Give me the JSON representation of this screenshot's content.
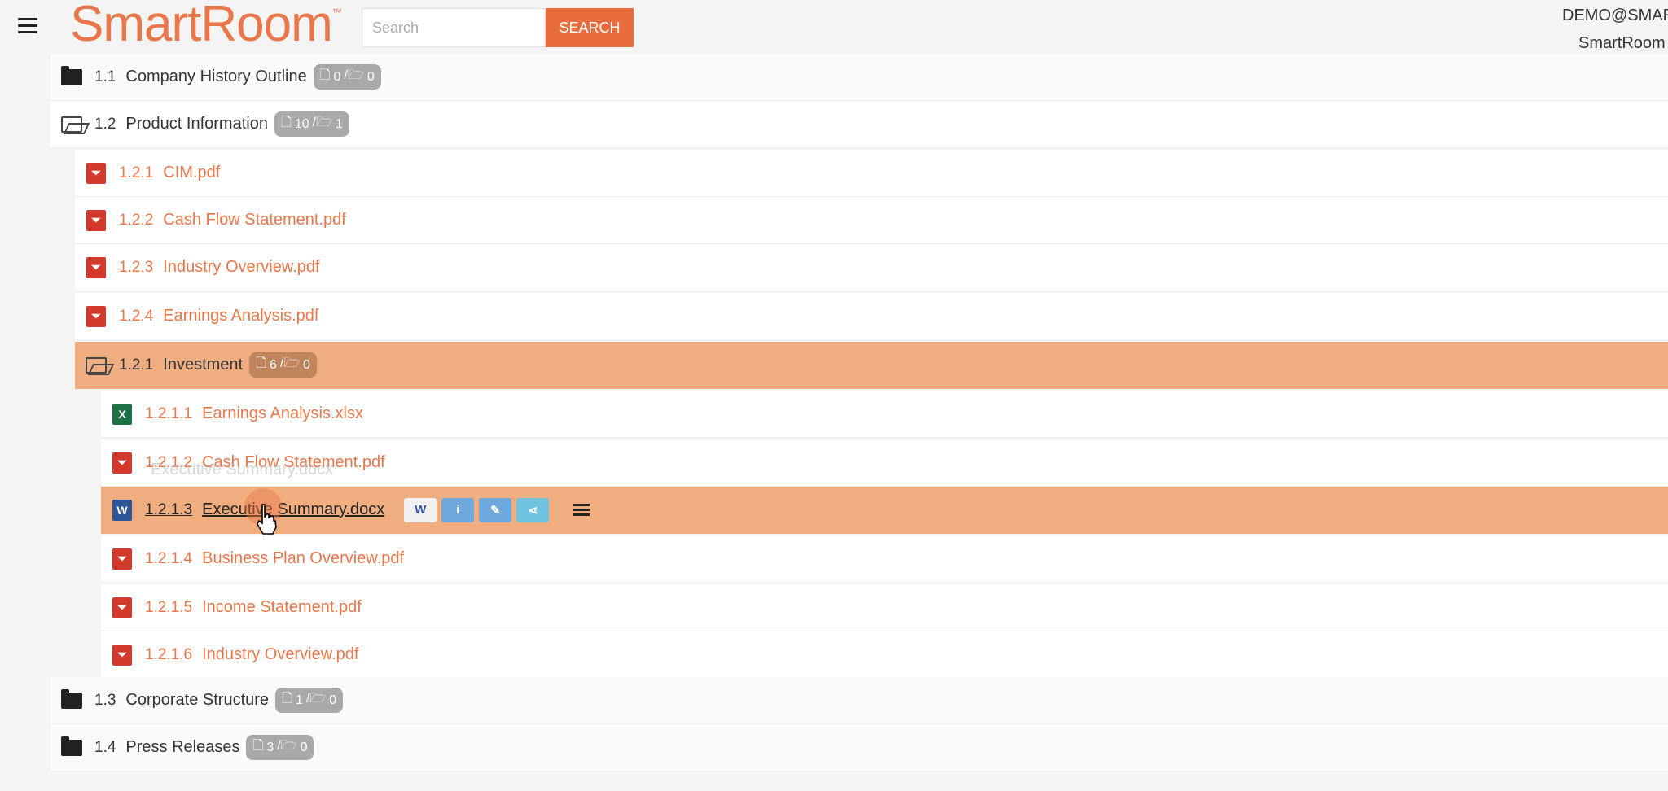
{
  "header": {
    "logo": "SmartRoom",
    "logo_tm": "™",
    "search_placeholder": "Search",
    "search_button": "SEARCH",
    "user": "DEMO@SMAR",
    "room": "SmartRoom"
  },
  "tree": [
    {
      "num": "1.1",
      "name": "Company History Outline",
      "type": "folder-closed",
      "files": "0",
      "folders": "0"
    },
    {
      "num": "1.2",
      "name": "Product Information",
      "type": "folder-open",
      "files": "10",
      "folders": "1"
    },
    {
      "num": "1.2.1",
      "name": "CIM.pdf",
      "type": "pdf"
    },
    {
      "num": "1.2.2",
      "name": "Cash Flow Statement.pdf",
      "type": "pdf"
    },
    {
      "num": "1.2.3",
      "name": "Industry Overview.pdf",
      "type": "pdf"
    },
    {
      "num": "1.2.4",
      "name": "Earnings Analysis.pdf",
      "type": "pdf"
    },
    {
      "num": "1.2.1",
      "name": "Investment",
      "type": "folder-open",
      "files": "6",
      "folders": "0",
      "highlight": true
    },
    {
      "num": "1.2.1.1",
      "name": "Earnings Analysis.xlsx",
      "type": "xlsx"
    },
    {
      "num": "1.2.1.2",
      "name": "Cash Flow Statement.pdf",
      "type": "pdf"
    },
    {
      "num": "1.2.1.3",
      "name": "Executive Summary.docx",
      "type": "docx",
      "highlight": true
    },
    {
      "num": "1.2.1.4",
      "name": "Business Plan Overview.pdf",
      "type": "pdf"
    },
    {
      "num": "1.2.1.5",
      "name": "Income Statement.pdf",
      "type": "pdf"
    },
    {
      "num": "1.2.1.6",
      "name": "Industry Overview.pdf",
      "type": "pdf"
    },
    {
      "num": "1.3",
      "name": "Corporate Structure",
      "type": "folder-closed",
      "files": "1",
      "folders": "0"
    },
    {
      "num": "1.4",
      "name": "Press Releases",
      "type": "folder-closed",
      "files": "3",
      "folders": "0"
    }
  ],
  "drag_ghost": "Executive Summary.docx",
  "icons": {
    "pdf": "pdf-icon",
    "xlsx": "excel-icon",
    "docx": "word-icon",
    "folder_open": "folder-open-icon",
    "folder_closed": "folder-icon"
  },
  "colors": {
    "accent": "#e9774a",
    "highlight": "#f0ad7f",
    "search_button": "#e96c3d"
  }
}
